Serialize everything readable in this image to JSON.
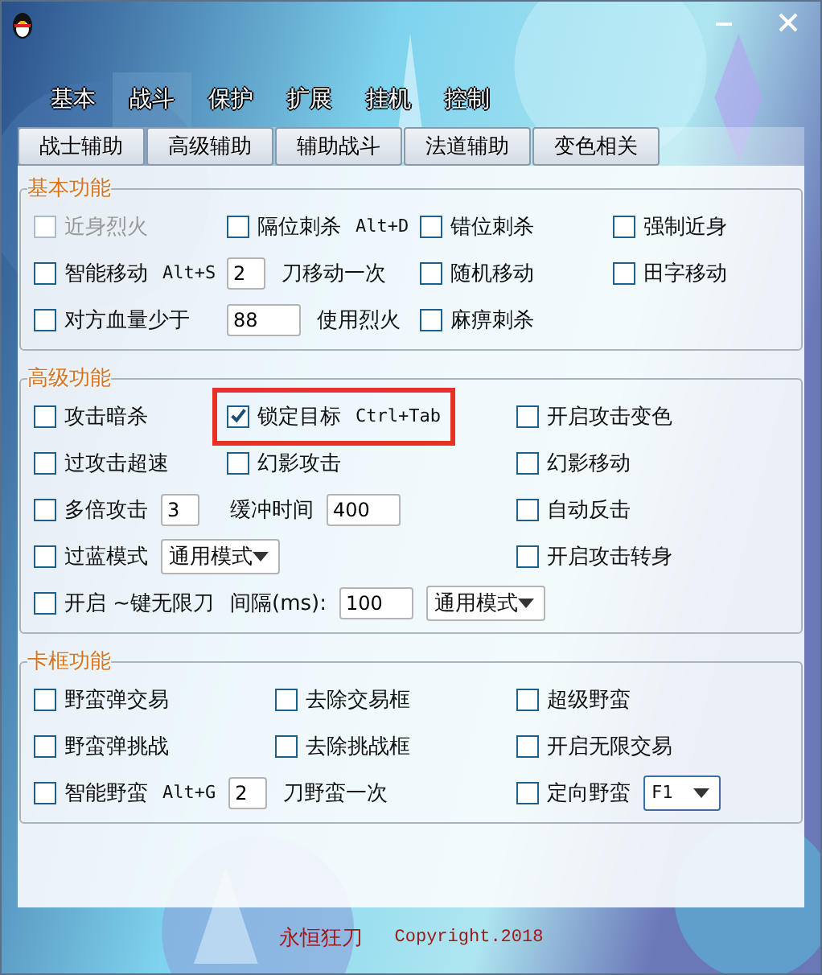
{
  "tabs": [
    {
      "label": "基本",
      "selected": false
    },
    {
      "label": "战斗",
      "selected": true
    },
    {
      "label": "保护",
      "selected": false
    },
    {
      "label": "扩展",
      "selected": false
    },
    {
      "label": "挂机",
      "selected": false
    },
    {
      "label": "控制",
      "selected": false
    }
  ],
  "subtabs": [
    {
      "label": "战士辅助",
      "selected": false
    },
    {
      "label": "高级辅助",
      "selected": false
    },
    {
      "label": "辅助战斗",
      "selected": false
    },
    {
      "label": "法道辅助",
      "selected": false
    },
    {
      "label": "变色相关",
      "selected": false
    }
  ],
  "groups": [
    {
      "title": "基本功能",
      "rows": [
        [
          [
            {
              "kind": "checkbox",
              "label": "近身烈火",
              "checked": false,
              "disabled": true
            }
          ],
          [
            {
              "kind": "checkbox",
              "label": "隔位刺杀",
              "hotkey": "Alt+D",
              "checked": false,
              "disabled": false
            }
          ],
          [
            {
              "kind": "checkbox",
              "label": "错位刺杀",
              "checked": false,
              "disabled": false
            }
          ],
          [
            {
              "kind": "checkbox",
              "label": "强制近身",
              "checked": false,
              "disabled": false
            }
          ]
        ],
        [
          [
            {
              "kind": "checkbox",
              "label": "智能移动",
              "hotkey": "Alt+S",
              "checked": false,
              "disabled": false
            }
          ],
          [
            {
              "kind": "input",
              "value": "2"
            },
            {
              "kind": "text",
              "text": "刀移动一次"
            }
          ],
          [
            {
              "kind": "checkbox",
              "label": "随机移动",
              "checked": false,
              "disabled": false
            }
          ],
          [
            {
              "kind": "checkbox",
              "label": "田字移动",
              "checked": false,
              "disabled": false
            }
          ]
        ],
        [
          [
            {
              "kind": "checkbox",
              "label": "对方血量少于",
              "checked": false,
              "disabled": false
            }
          ],
          [
            {
              "kind": "input",
              "value": "88"
            },
            {
              "kind": "text",
              "text": "使用烈火"
            }
          ],
          [
            {
              "kind": "checkbox",
              "label": "麻痹刺杀",
              "checked": false,
              "disabled": false
            }
          ],
          []
        ]
      ]
    },
    {
      "title": "高级功能",
      "rows": [
        [
          [
            {
              "kind": "checkbox",
              "label": "攻击暗杀",
              "checked": false,
              "disabled": false
            }
          ],
          [
            {
              "kind": "checkbox",
              "label": "锁定目标",
              "hotkey": "Ctrl+Tab",
              "checked": true,
              "disabled": false,
              "highlighted": true
            }
          ],
          [
            {
              "kind": "checkbox",
              "label": "开启攻击变色",
              "checked": false,
              "disabled": false
            }
          ]
        ],
        [
          [
            {
              "kind": "checkbox",
              "label": "过攻击超速",
              "checked": false,
              "disabled": false
            }
          ],
          [
            {
              "kind": "checkbox",
              "label": "幻影攻击",
              "checked": false,
              "disabled": false
            }
          ],
          [
            {
              "kind": "checkbox",
              "label": "幻影移动",
              "checked": false,
              "disabled": false
            }
          ]
        ],
        [
          [
            {
              "kind": "checkbox",
              "label": "多倍攻击",
              "checked": false,
              "disabled": false
            },
            {
              "kind": "input",
              "value": "3"
            }
          ],
          [
            {
              "kind": "text",
              "text": "缓冲时间"
            },
            {
              "kind": "input",
              "value": "400"
            }
          ],
          [
            {
              "kind": "checkbox",
              "label": "自动反击",
              "checked": false,
              "disabled": false
            }
          ]
        ],
        [
          [
            {
              "kind": "checkbox",
              "label": "过蓝模式",
              "checked": false,
              "disabled": false
            },
            {
              "kind": "dropdown",
              "value": "通用模式"
            }
          ],
          [],
          [
            {
              "kind": "checkbox",
              "label": "开启攻击转身",
              "checked": false,
              "disabled": false
            }
          ]
        ],
        [
          [
            {
              "kind": "checkbox",
              "label": "开启 ~键无限刀",
              "checked": false,
              "disabled": false
            },
            {
              "kind": "text",
              "text": "间隔(ms):"
            },
            {
              "kind": "input",
              "value": "100"
            },
            {
              "kind": "dropdown",
              "value": "通用模式"
            }
          ]
        ]
      ]
    },
    {
      "title": "卡框功能",
      "rows": [
        [
          [
            {
              "kind": "checkbox",
              "label": "野蛮弹交易",
              "checked": false,
              "disabled": false
            }
          ],
          [
            {
              "kind": "checkbox",
              "label": "去除交易框",
              "checked": false,
              "disabled": false
            }
          ],
          [
            {
              "kind": "checkbox",
              "label": "超级野蛮",
              "checked": false,
              "disabled": false
            }
          ]
        ],
        [
          [
            {
              "kind": "checkbox",
              "label": "野蛮弹挑战",
              "checked": false,
              "disabled": false
            }
          ],
          [
            {
              "kind": "checkbox",
              "label": "去除挑战框",
              "checked": false,
              "disabled": false
            }
          ],
          [
            {
              "kind": "checkbox",
              "label": "开启无限交易",
              "checked": false,
              "disabled": false
            }
          ]
        ],
        [
          [
            {
              "kind": "checkbox",
              "label": "智能野蛮",
              "hotkey": "Alt+G",
              "checked": false,
              "disabled": false
            },
            {
              "kind": "input",
              "value": "2"
            },
            {
              "kind": "text",
              "text": "刀野蛮一次"
            }
          ],
          [],
          [
            {
              "kind": "checkbox",
              "label": "定向野蛮",
              "checked": false,
              "disabled": false
            },
            {
              "kind": "dropdown",
              "value": "F1"
            }
          ]
        ]
      ]
    }
  ],
  "footer": {
    "name": "永恒狂刀",
    "copyright": "Copyright.2018"
  }
}
